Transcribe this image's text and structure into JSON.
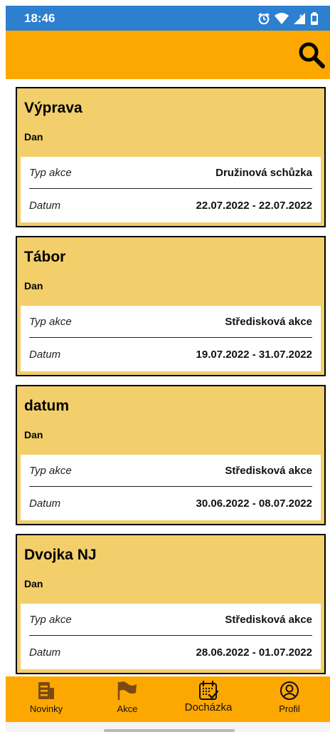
{
  "status_bar": {
    "time": "18:46"
  },
  "colors": {
    "accent": "#fca800",
    "card": "#f2cf6b",
    "status_bar": "#2d7fcf",
    "icon_brown": "#7a4a12"
  },
  "events": [
    {
      "title": "Výprava",
      "author": "Dan",
      "type_label": "Typ akce",
      "type_value": "Družinová schůzka",
      "date_label": "Datum",
      "date_value": "22.07.2022 - 22.07.2022"
    },
    {
      "title": "Tábor",
      "author": "Dan",
      "type_label": "Typ akce",
      "type_value": "Středisková akce",
      "date_label": "Datum",
      "date_value": "19.07.2022 - 31.07.2022"
    },
    {
      "title": "datum",
      "author": "Dan",
      "type_label": "Typ akce",
      "type_value": "Středisková akce",
      "date_label": "Datum",
      "date_value": "30.06.2022 - 08.07.2022"
    },
    {
      "title": "Dvojka NJ",
      "author": "Dan",
      "type_label": "Typ akce",
      "type_value": "Středisková akce",
      "date_label": "Datum",
      "date_value": "28.06.2022 - 01.07.2022"
    }
  ],
  "nav": [
    {
      "label": "Novinky",
      "icon": "news-icon"
    },
    {
      "label": "Akce",
      "icon": "flag-icon"
    },
    {
      "label": "Docházka",
      "icon": "calendar-check-icon",
      "active": true
    },
    {
      "label": "Profil",
      "icon": "profile-icon"
    }
  ]
}
